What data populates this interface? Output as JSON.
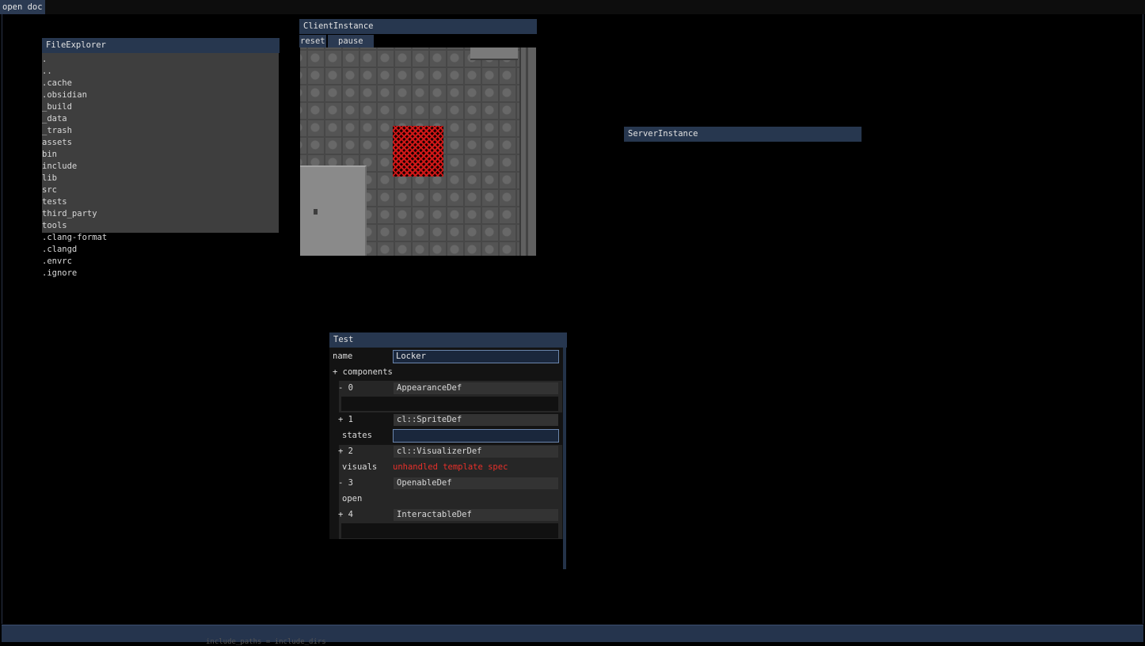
{
  "menubar": {
    "open_doc": "open doc"
  },
  "file_explorer": {
    "title": "FileExplorer",
    "entries": [
      ".",
      "..",
      ".cache",
      ".obsidian",
      "_build",
      "_data",
      "_trash",
      "assets",
      "bin",
      "include",
      "lib",
      "src",
      "tests",
      "third_party",
      "tools",
      ".clang-format",
      ".clangd",
      ".envrc",
      ".ignore"
    ]
  },
  "client_instance": {
    "title": "ClientInstance",
    "reset_label": "reset",
    "pause_label": "pause"
  },
  "server_instance": {
    "title": "ServerInstance"
  },
  "test": {
    "title": "Test",
    "name_label": "name",
    "name_value": "Locker",
    "components_label": "+ components",
    "components": [
      {
        "toggle": "- 0",
        "type": "AppearanceDef"
      },
      {
        "toggle": "+ 1",
        "type": "cl::SpriteDef",
        "field_label": "states",
        "field_value": ""
      },
      {
        "toggle": "+ 2",
        "type": "cl::VisualizerDef",
        "field_label": "visuals",
        "error": "unhandled template spec"
      },
      {
        "toggle": "- 3",
        "type": "OpenableDef",
        "field_label": "open"
      },
      {
        "toggle": "+ 4",
        "type": "InteractableDef"
      }
    ]
  },
  "status_bar": {
    "ghost_text": "include_paths = include_dirs"
  }
}
